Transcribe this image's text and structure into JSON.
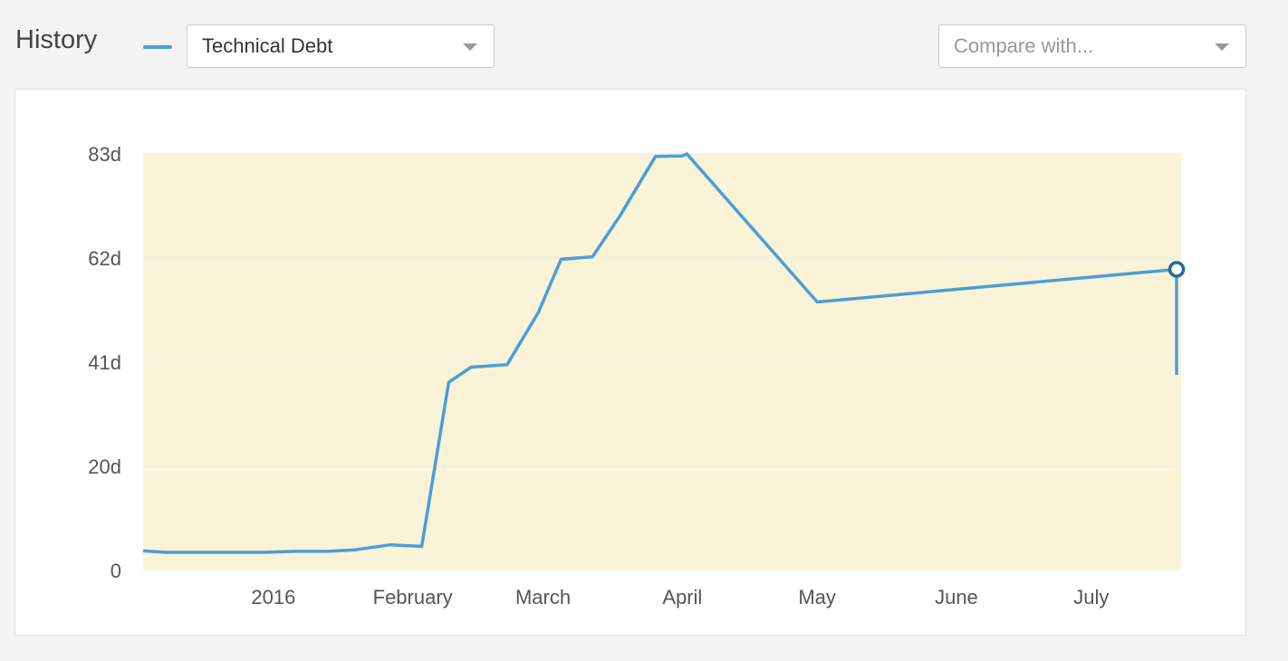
{
  "header": {
    "title": "History",
    "metric_select": {
      "value": "Technical Debt"
    },
    "compare_select": {
      "placeholder": "Compare with..."
    }
  },
  "colors": {
    "series": "#4b9fd5",
    "marker": "#236a97",
    "plot_background": "#faf3d7",
    "gridline": "#eeeeee"
  },
  "chart_data": {
    "type": "line",
    "xlabel": "",
    "ylabel": "",
    "unit": "days",
    "grid": true,
    "x_range": [
      "2015-12-03",
      "2016-07-21"
    ],
    "ylim": [
      0,
      83
    ],
    "y_ticks": [
      {
        "value": 0,
        "label": "0"
      },
      {
        "value": 20.75,
        "label": "20d"
      },
      {
        "value": 41.5,
        "label": "41d"
      },
      {
        "value": 62.25,
        "label": "62d"
      },
      {
        "value": 83,
        "label": "83d"
      }
    ],
    "x_ticks": [
      {
        "date": "2016-01-01",
        "label": "2016"
      },
      {
        "date": "2016-02-01",
        "label": "February"
      },
      {
        "date": "2016-03-01",
        "label": "March"
      },
      {
        "date": "2016-04-01",
        "label": "April"
      },
      {
        "date": "2016-05-01",
        "label": "May"
      },
      {
        "date": "2016-06-01",
        "label": "June"
      },
      {
        "date": "2016-07-01",
        "label": "July"
      }
    ],
    "series": [
      {
        "points": [
          {
            "x": "2015-12-03",
            "y": 3.9
          },
          {
            "x": "2015-12-08",
            "y": 3.6
          },
          {
            "x": "2015-12-30",
            "y": 3.6
          },
          {
            "x": "2016-01-06",
            "y": 3.8
          },
          {
            "x": "2016-01-13",
            "y": 3.8
          },
          {
            "x": "2016-01-19",
            "y": 4.1
          },
          {
            "x": "2016-01-27",
            "y": 5.1
          },
          {
            "x": "2016-02-03",
            "y": 4.8
          },
          {
            "x": "2016-02-09",
            "y": 37.5
          },
          {
            "x": "2016-02-14",
            "y": 40.5
          },
          {
            "x": "2016-02-22",
            "y": 41.0
          },
          {
            "x": "2016-02-29",
            "y": 51.5
          },
          {
            "x": "2016-03-05",
            "y": 62.0
          },
          {
            "x": "2016-03-12",
            "y": 62.5
          },
          {
            "x": "2016-03-18",
            "y": 70.5
          },
          {
            "x": "2016-03-26",
            "y": 82.5
          },
          {
            "x": "2016-04-01",
            "y": 82.6
          },
          {
            "x": "2016-04-02",
            "y": 83.0
          },
          {
            "x": "2016-05-01",
            "y": 53.5
          },
          {
            "x": "2016-07-20",
            "y": 60.0
          },
          {
            "x": "2016-07-20",
            "y": 39.0
          }
        ]
      }
    ],
    "highlighted_point": {
      "x": "2016-07-20",
      "y": 60.0
    }
  }
}
